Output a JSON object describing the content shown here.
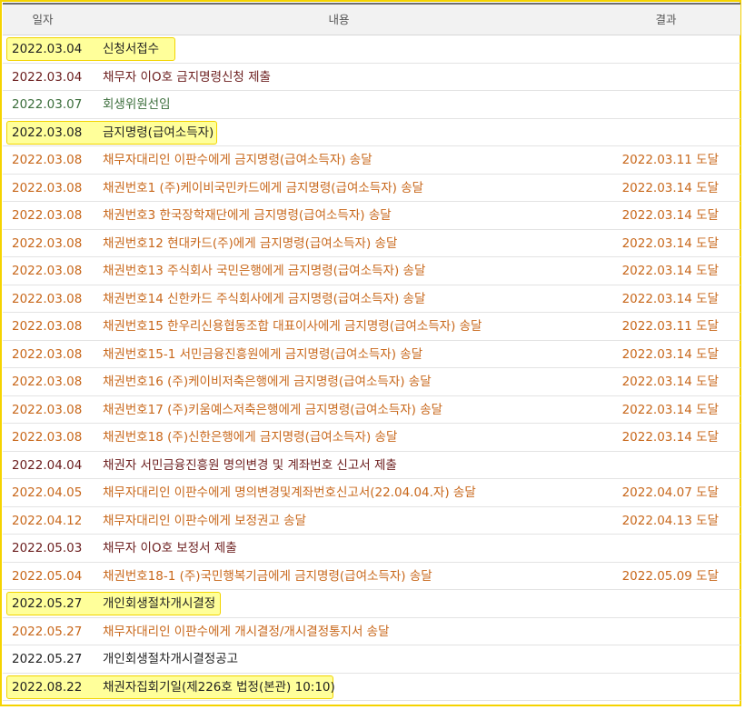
{
  "header": {
    "date": "일자",
    "content": "내용",
    "result": "결과"
  },
  "colors": {
    "black": "#222222",
    "maroon": "#6b1d1d",
    "green": "#3c6e3c",
    "orange": "#c8671a",
    "highlight": "#ffff9a"
  },
  "rows": [
    {
      "date": "2022.03.04",
      "content": "신청서접수",
      "result": "",
      "color": "black",
      "highlighted": true
    },
    {
      "date": "2022.03.04",
      "content": "채무자 이O호 금지명령신청 제출",
      "result": "",
      "color": "maroon",
      "highlighted": false
    },
    {
      "date": "2022.03.07",
      "content": "회생위원선임",
      "result": "",
      "color": "green",
      "highlighted": false
    },
    {
      "date": "2022.03.08",
      "content": "금지명령(급여소득자)",
      "result": "",
      "color": "black",
      "highlighted": true
    },
    {
      "date": "2022.03.08",
      "content": "채무자대리인 이판수에게 금지명령(급여소득자) 송달",
      "result": "2022.03.11 도달",
      "color": "orange",
      "highlighted": false
    },
    {
      "date": "2022.03.08",
      "content": "채권번호1 (주)케이비국민카드에게 금지명령(급여소득자) 송달",
      "result": "2022.03.14 도달",
      "color": "orange",
      "highlighted": false
    },
    {
      "date": "2022.03.08",
      "content": "채권번호3 한국장학재단에게 금지명령(급여소득자) 송달",
      "result": "2022.03.14 도달",
      "color": "orange",
      "highlighted": false
    },
    {
      "date": "2022.03.08",
      "content": "채권번호12 현대카드(주)에게 금지명령(급여소득자) 송달",
      "result": "2022.03.14 도달",
      "color": "orange",
      "highlighted": false
    },
    {
      "date": "2022.03.08",
      "content": "채권번호13 주식회사 국민은행에게 금지명령(급여소득자) 송달",
      "result": "2022.03.14 도달",
      "color": "orange",
      "highlighted": false
    },
    {
      "date": "2022.03.08",
      "content": "채권번호14 신한카드 주식회사에게 금지명령(급여소득자) 송달",
      "result": "2022.03.14 도달",
      "color": "orange",
      "highlighted": false
    },
    {
      "date": "2022.03.08",
      "content": "채권번호15 한우리신용협동조합 대표이사에게 금지명령(급여소득자) 송달",
      "result": "2022.03.11 도달",
      "color": "orange",
      "highlighted": false
    },
    {
      "date": "2022.03.08",
      "content": "채권번호15-1 서민금융진흥원에게 금지명령(급여소득자) 송달",
      "result": "2022.03.14 도달",
      "color": "orange",
      "highlighted": false
    },
    {
      "date": "2022.03.08",
      "content": "채권번호16 (주)케이비저축은행에게 금지명령(급여소득자) 송달",
      "result": "2022.03.14 도달",
      "color": "orange",
      "highlighted": false
    },
    {
      "date": "2022.03.08",
      "content": "채권번호17 (주)키움예스저축은행에게 금지명령(급여소득자) 송달",
      "result": "2022.03.14 도달",
      "color": "orange",
      "highlighted": false
    },
    {
      "date": "2022.03.08",
      "content": "채권번호18 (주)신한은행에게 금지명령(급여소득자) 송달",
      "result": "2022.03.14 도달",
      "color": "orange",
      "highlighted": false
    },
    {
      "date": "2022.04.04",
      "content": "채권자 서민금융진흥원 명의변경 및 계좌번호 신고서 제출",
      "result": "",
      "color": "maroon",
      "highlighted": false
    },
    {
      "date": "2022.04.05",
      "content": "채무자대리인 이판수에게 명의변경및계좌번호신고서(22.04.04.자) 송달",
      "result": "2022.04.07 도달",
      "color": "orange",
      "highlighted": false
    },
    {
      "date": "2022.04.12",
      "content": "채무자대리인 이판수에게 보정권고 송달",
      "result": "2022.04.13 도달",
      "color": "orange",
      "highlighted": false
    },
    {
      "date": "2022.05.03",
      "content": "채무자 이O호 보정서 제출",
      "result": "",
      "color": "maroon",
      "highlighted": false
    },
    {
      "date": "2022.05.04",
      "content": "채권번호18-1 (주)국민행복기금에게 금지명령(급여소득자) 송달",
      "result": "2022.05.09 도달",
      "color": "orange",
      "highlighted": false
    },
    {
      "date": "2022.05.27",
      "content": "개인회생절차개시결정",
      "result": "",
      "color": "black",
      "highlighted": true
    },
    {
      "date": "2022.05.27",
      "content": "채무자대리인 이판수에게 개시결정/개시결정통지서 송달",
      "result": "",
      "color": "orange",
      "highlighted": false
    },
    {
      "date": "2022.05.27",
      "content": "개인회생절차개시결정공고",
      "result": "",
      "color": "black",
      "highlighted": false
    },
    {
      "date": "2022.08.22",
      "content": "채권자집회기일(제226호 법정(본관) 10:10)",
      "result": "",
      "color": "black",
      "highlighted": true
    }
  ]
}
